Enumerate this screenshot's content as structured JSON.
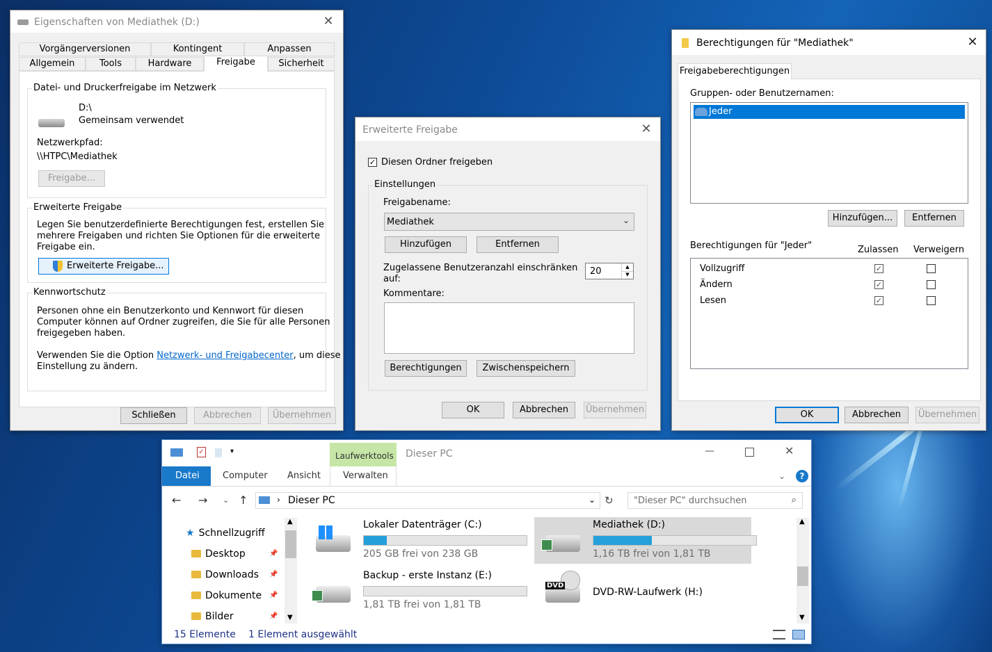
{
  "props": {
    "title": "Eigenschaften von Mediathek (D:)",
    "tabs_row1": [
      "Vorgängerversionen",
      "Kontingent",
      "Anpassen"
    ],
    "tabs_row2": [
      "Allgemein",
      "Tools",
      "Hardware",
      "Freigabe",
      "Sicherheit"
    ],
    "net_group": "Datei- und Druckerfreigabe im Netzwerk",
    "drive_path": "D:\\",
    "drive_state": "Gemeinsam verwendet",
    "netpath_label": "Netzwerkpfad:",
    "netpath_value": "\\\\HTPC\\Mediathek",
    "share_btn": "Freigabe...",
    "adv_group": "Erweiterte Freigabe",
    "adv_text1": "Legen Sie benutzerdefinierte Berechtigungen fest, erstellen Sie",
    "adv_text2": "mehrere Freigaben und richten Sie Optionen für die erweiterte",
    "adv_text3": "Freigabe ein.",
    "adv_btn": "Erweiterte Freigabe...",
    "pw_group": "Kennwortschutz",
    "pw_text1": "Personen ohne ein Benutzerkonto und Kennwort für diesen",
    "pw_text2": "Computer können auf Ordner zugreifen, die Sie für alle Personen",
    "pw_text3": "freigegeben haben.",
    "pw_text4a": "Verwenden Sie die Option ",
    "pw_link": "Netzwerk- und Freigabecenter",
    "pw_text4b": ", um diese",
    "pw_text5": "Einstellung zu ändern.",
    "btn_close": "Schließen",
    "btn_cancel": "Abbrechen",
    "btn_apply": "Übernehmen"
  },
  "adv": {
    "title": "Erweiterte Freigabe",
    "share_checkbox": "Diesen Ordner freigeben",
    "share_checked": true,
    "settings_group": "Einstellungen",
    "name_label": "Freigabename:",
    "name_value": "Mediathek",
    "btn_add": "Hinzufügen",
    "btn_remove": "Entfernen",
    "limit_label1": "Zugelassene Benutzeranzahl einschränken",
    "limit_label2": "auf:",
    "limit_value": "20",
    "comments_label": "Kommentare:",
    "btn_perms": "Berechtigungen",
    "btn_cache": "Zwischenspeichern",
    "btn_ok": "OK",
    "btn_cancel": "Abbrechen",
    "btn_apply": "Übernehmen"
  },
  "perm": {
    "title": "Berechtigungen für \"Mediathek\"",
    "tab": "Freigabeberechtigungen",
    "groups_label": "Gruppen- oder Benutzernamen:",
    "groups": [
      "Jeder"
    ],
    "btn_add": "Hinzufügen...",
    "btn_remove": "Entfernen",
    "perms_for": "Berechtigungen für \"Jeder\"",
    "col_allow": "Zulassen",
    "col_deny": "Verweigern",
    "rows": [
      {
        "name": "Vollzugriff",
        "allow": true,
        "deny": false
      },
      {
        "name": "Ändern",
        "allow": true,
        "deny": false
      },
      {
        "name": "Lesen",
        "allow": true,
        "deny": false
      }
    ],
    "btn_ok": "OK",
    "btn_cancel": "Abbrechen",
    "btn_apply": "Übernehmen"
  },
  "explorer": {
    "context_tab": "Laufwerktools",
    "title": "Dieser PC",
    "ribbon_tabs": [
      "Datei",
      "Computer",
      "Ansicht",
      "Verwalten"
    ],
    "address": "Dieser PC",
    "search_placeholder": "\"Dieser PC\" durchsuchen",
    "nav": [
      {
        "label": "Schnellzugriff",
        "pinned": false
      },
      {
        "label": "Desktop",
        "pinned": true
      },
      {
        "label": "Downloads",
        "pinned": true
      },
      {
        "label": "Dokumente",
        "pinned": true
      },
      {
        "label": "Bilder",
        "pinned": true
      }
    ],
    "drives": [
      {
        "name": "Lokaler Datenträger (C:)",
        "free": "205 GB frei von 238 GB",
        "used_fraction": 0.14,
        "icon": "windows-drive-icon",
        "selected": false
      },
      {
        "name": "Mediathek (D:)",
        "free": "1,16 TB frei von 1,81 TB",
        "used_fraction": 0.36,
        "icon": "shared-drive-icon",
        "selected": true
      },
      {
        "name": "Backup - erste Instanz (E:)",
        "free": "1,81 TB frei von 1,81 TB",
        "used_fraction": 0.0,
        "icon": "shared-drive-icon",
        "selected": false
      },
      {
        "name": "DVD-RW-Laufwerk (H:)",
        "free": "",
        "used_fraction": null,
        "icon": "dvd-drive-icon",
        "selected": false
      }
    ],
    "dvd_label": "DVD",
    "status_count": "15 Elemente",
    "status_selected": "1 Element ausgewählt"
  },
  "colors": {
    "accent": "#0078d7",
    "selection": "#cce8ff",
    "bar": "#26a0da",
    "ribbon_context": "#c5e6a6"
  }
}
